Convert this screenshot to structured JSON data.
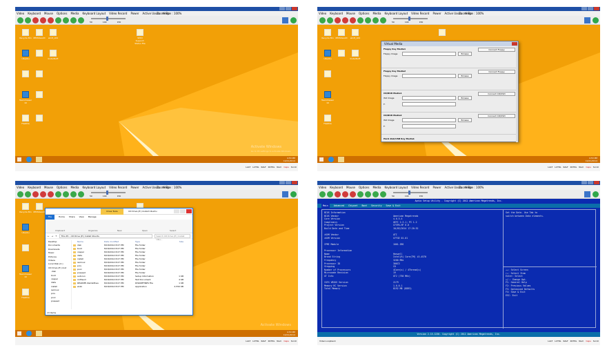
{
  "kvm": {
    "window_title": "",
    "menu": [
      "Video",
      "Keyboard",
      "Mouse",
      "Options",
      "Media",
      "Keyboard Layout",
      "Video Record",
      "Power",
      "Active Users",
      "Help"
    ],
    "zoom_size": "Zoom Size : 100%",
    "zoom_ticks": [
      "50",
      "100",
      "150"
    ],
    "status_leds": [
      "LALT",
      "LCTRL",
      "RALT",
      "RCTRL",
      "Num",
      "Caps",
      "Scroll"
    ],
    "status_left_bios": "Video Loopback"
  },
  "desktop": {
    "icons": [
      "Recycle Bin",
      "IPMIView20",
      "win8_x64",
      "",
      "Ubuntu",
      "InstallSoft",
      "TeamViewer 10",
      "",
      "FileZilla",
      "",
      "SMCI Support: Status File"
    ],
    "watermark_title": "Activate Windows",
    "watermark_text": "Go to PC settings to activate Windows.",
    "clock_time": "4:53 PM",
    "clock_date": "10/21/2014"
  },
  "virtual_media": {
    "title": "Virtual Media",
    "sections": [
      {
        "heading": "Floppy Key Media1",
        "radio1": "Floppy Image",
        "radio2": "",
        "browse": "Browse",
        "connect": "Connect Floppy"
      },
      {
        "heading": "Floppy Key Media2",
        "radio1": "Floppy Image",
        "radio2": "",
        "browse": "Browse",
        "connect": "Connect Floppy"
      },
      {
        "heading": "CD/DVD Media1",
        "radio1": "ISO Image",
        "radio2": "F:",
        "browse": "Browse",
        "connect": "Connect CD/DVD"
      },
      {
        "heading": "CD/DVD Media2",
        "radio1": "ISO Image",
        "radio2": "F:",
        "browse": "Browse",
        "connect": "Connect CD/DVD"
      }
    ],
    "last_heading": "Hard disk/USB Key Media1"
  },
  "explorer": {
    "drive_tools": "Drive Tools",
    "title": "CD Drive (E:) Install Ubuntu",
    "tabs": [
      "File",
      "Home",
      "Share",
      "View",
      "Manage"
    ],
    "ribbon_groups": [
      "Clipboard",
      "Organize",
      "New",
      "Open",
      "Select"
    ],
    "address": "This PC › CD Drive (E:) Install Ubuntu",
    "search_placeholder": "Search CD Drive (E:) Install Ubu...",
    "nav": [
      "Desktop",
      "Documents",
      "Downloads",
      "Music",
      "Pictures",
      "Videos",
      "Local Disk (C:)",
      "CD Drive (E:) Inst",
      ".disk",
      "boot",
      "casper",
      "dists",
      "install",
      "isolinux",
      "pics",
      "pool",
      "preseed"
    ],
    "columns": [
      "Name",
      "Date modified",
      "Type",
      "Size"
    ],
    "rows": [
      [
        "disk",
        "8/18/2014 8:07 PM",
        "File folder",
        ""
      ],
      [
        "boot",
        "8/18/2014 8:07 PM",
        "File folder",
        ""
      ],
      [
        "casper",
        "8/18/2014 8:07 PM",
        "File folder",
        ""
      ],
      [
        "dists",
        "8/18/2014 8:07 PM",
        "File folder",
        ""
      ],
      [
        "install",
        "8/18/2014 8:07 PM",
        "File folder",
        ""
      ],
      [
        "isolinux",
        "8/18/2014 8:07 PM",
        "File folder",
        ""
      ],
      [
        "pics",
        "8/18/2014 8:07 PM",
        "File folder",
        ""
      ],
      [
        "pool",
        "8/18/2014 8:07 PM",
        "File folder",
        ""
      ],
      [
        "preseed",
        "8/18/2014 8:07 PM",
        "File folder",
        ""
      ],
      [
        "autorun",
        "8/18/2014 8:07 PM",
        "Setup Information",
        "1 KB"
      ],
      [
        "md5sum",
        "8/18/2014 8:07 PM",
        "Text Document",
        "4 KB"
      ],
      [
        "README.diskdefines",
        "8/18/2014 8:07 PM",
        "DISKDEFINES File",
        "1 KB"
      ],
      [
        "wubi",
        "8/18/2014 8:07 PM",
        "Application",
        "2,550 KB"
      ]
    ],
    "status": "13 items"
  },
  "bios": {
    "header": "Aptio Setup Utility - Copyright (C) 2012 American Megatrends, Inc.",
    "tabs": [
      "Main",
      "Advanced",
      "Chipset",
      "Boot",
      "Security",
      "Save & Exit"
    ],
    "rows": [
      [
        "BIOS Information",
        ""
      ],
      [
        "BIOS Vendor",
        "American Megatrends"
      ],
      [
        "Core Version",
        "4.6.5.4"
      ],
      [
        "Compliancy",
        "UEFI 2.3.1; PI 1.2"
      ],
      [
        "Project Version",
        "X7SPA-HF 0.0"
      ],
      [
        "Build Date and Time",
        "10/03/2014 17:20:52"
      ],
      [
        "",
        ""
      ],
      [
        "iKVM Vendor",
        "ATI"
      ],
      [
        "iKVM Version",
        "X7TGE 01.01"
      ],
      [
        "",
        ""
      ],
      [
        "IPMI Module",
        "1001-IBS"
      ],
      [
        "",
        ""
      ],
      [
        "Processor Information",
        ""
      ],
      [
        "Name",
        "Haswell"
      ],
      [
        "Brand String",
        "Intel(R) Core(TM) i5-4570"
      ],
      [
        "Frequency",
        "3200 MHz"
      ],
      [
        "Processor ID",
        "306C3"
      ],
      [
        "Stepping",
        "C0"
      ],
      [
        "Number of Processors",
        "4Core(s) / 4Thread(s)"
      ],
      [
        "Microcode Revision",
        "19"
      ],
      [
        "GT Info",
        "GT2 (750 MHz)"
      ],
      [
        "",
        ""
      ],
      [
        "IGFX VBIOS Version",
        "2179"
      ],
      [
        "Memory RC Version",
        "1.6.0.1"
      ],
      [
        "Total Memory",
        "8192 MB (DDR3)"
      ]
    ],
    "help": [
      "Set the Date. Use Tab to",
      "switch between Data elements."
    ],
    "keys": [
      "→←: Select Screen",
      "↑↓: Select Item",
      "Enter: Select",
      "+/-: Change Opt.",
      "F1: General Help",
      "F2: Previous Values",
      "F3: Optimized Defaults",
      "F4: Save & Exit",
      "ESC: Exit"
    ],
    "footer": "Version 2.15.1236. Copyright (C) 2012 American Megatrends, Inc."
  }
}
